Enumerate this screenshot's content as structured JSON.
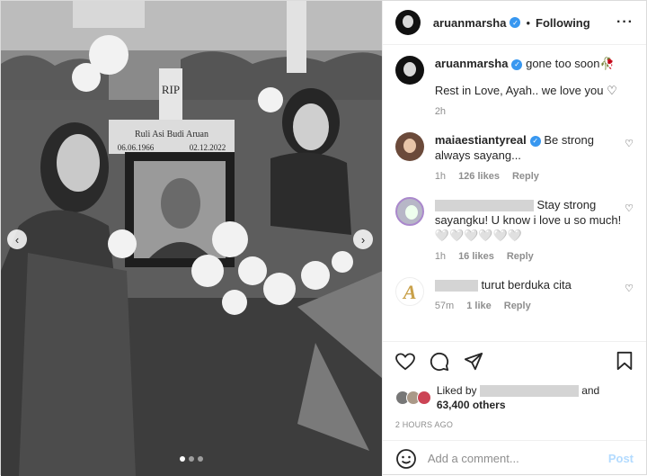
{
  "header": {
    "username": "aruanmarsha",
    "follow_status": "Following",
    "more_icon": "more-horizontal-icon"
  },
  "photo": {
    "grave_text_rip": "RIP",
    "grave_text_name": "Ruli Asi Budi Aruan",
    "grave_text_born": "06.06.1966",
    "grave_text_died": "02.12.2022",
    "carousel_count": 3,
    "carousel_active": 0
  },
  "caption": {
    "username": "aruanmarsha",
    "line1": "gone too soon🥀",
    "line2": "Rest in Love, Ayah.. we love you ♡",
    "time": "2h"
  },
  "comments": [
    {
      "username": "maiaestiantyreal",
      "text": "Be strong always sayang...",
      "time": "1h",
      "likes": "126 likes",
      "reply": "Reply"
    },
    {
      "username": "",
      "text": "Stay strong sayangku! U know i love u so much! 🤍🤍🤍🤍🤍🤍",
      "time": "1h",
      "likes": "16 likes",
      "reply": "Reply"
    },
    {
      "username": "",
      "text": "turut berduka cita",
      "time": "57m",
      "likes": "1 like",
      "reply": "Reply"
    }
  ],
  "actions": {
    "liked_by_prefix": "Liked by",
    "liked_by_and": "and",
    "others": "63,400 others",
    "timestamp": "2 HOURS AGO"
  },
  "add_comment": {
    "placeholder": "Add a comment...",
    "post_label": "Post"
  },
  "colors": {
    "verified": "#3897f0",
    "post_disabled": "#b3dbff",
    "meta_gray": "#8e8e8e"
  }
}
